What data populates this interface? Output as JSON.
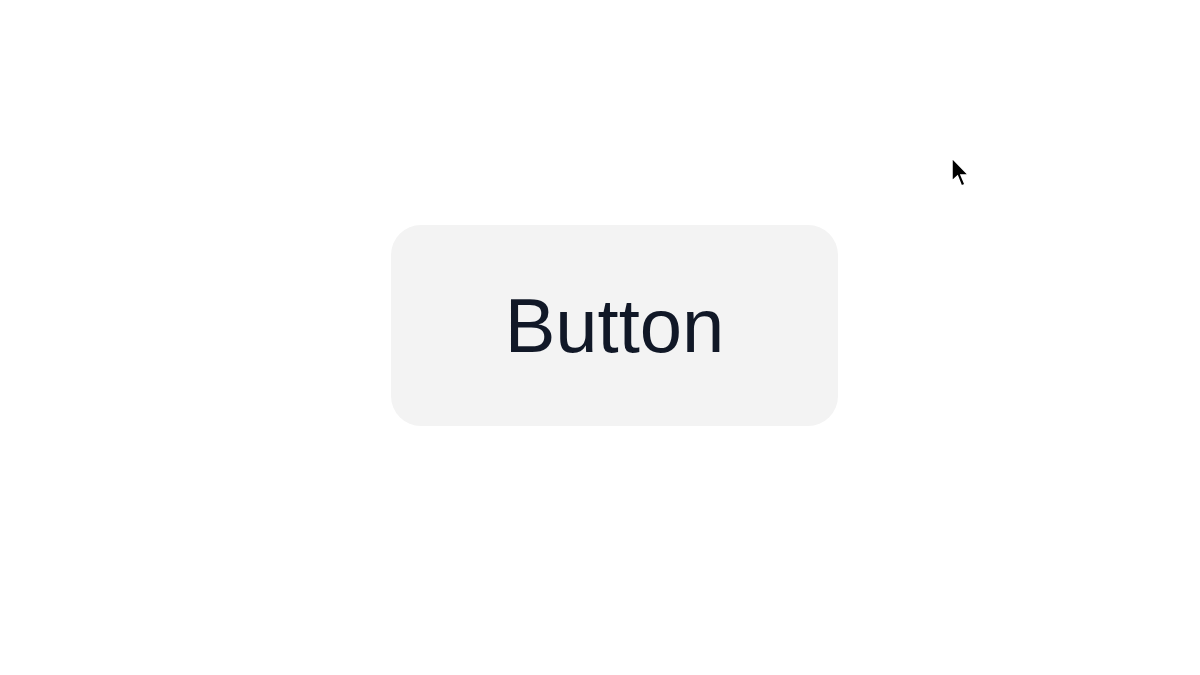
{
  "button": {
    "label": "Button"
  }
}
